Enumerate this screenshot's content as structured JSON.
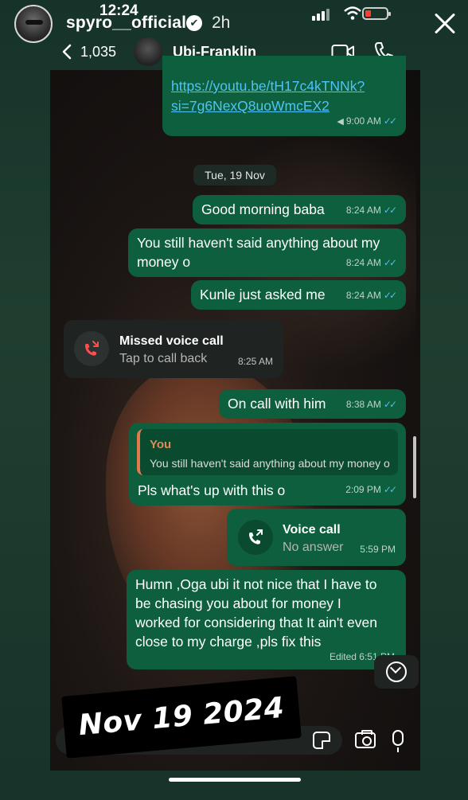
{
  "story": {
    "time": "12:24",
    "username": "spyro__official",
    "verified_mark": "✔",
    "age": "2h",
    "sticker_text": "Nov 19 2024"
  },
  "chat_header": {
    "back_count": "1,035",
    "contact_name": "Ubi-Franklin"
  },
  "messages": {
    "link": {
      "line1": "https://youtu.be/tH17c4kTNNk?",
      "line2": "si=7g6NexQ8uoWmcEX2",
      "time": "9:00 AM",
      "ticks": "✓✓"
    },
    "date_chip": "Tue, 19 Nov",
    "m1": {
      "text": "Good morning baba",
      "time": "8:24 AM",
      "ticks": "✓✓"
    },
    "m2": {
      "line1": "You still haven't said anything about my",
      "line2": "money o",
      "time": "8:24 AM",
      "ticks": "✓✓"
    },
    "m3": {
      "text": "Kunle just asked me",
      "time": "8:24 AM",
      "ticks": "✓✓"
    },
    "missed_call": {
      "title": "Missed voice call",
      "sub": "Tap to call back",
      "time": "8:25 AM"
    },
    "m4": {
      "text": "On call with him",
      "time": "8:38 AM",
      "ticks": "✓✓"
    },
    "reply": {
      "quote_name": "You",
      "quote_text": "You still haven't said anything about my money o",
      "text": "Pls what's up with this o",
      "time": "2:09 PM",
      "ticks": "✓✓"
    },
    "voice_call": {
      "title": "Voice call",
      "sub": "No answer",
      "time": "5:59 PM"
    },
    "m5": {
      "line1": "Humn ,Oga ubi it not nice that I have to",
      "line2": "be chasing you about for money I",
      "line3": "worked for considering that It ain't even",
      "line4": "close to my charge ,pls fix this",
      "time": "Edited 6:51 PM"
    }
  },
  "colors": {
    "outgoing_bubble": "#0d5f3d",
    "incoming_bubble": "#1f2422",
    "read_ticks": "#53bdeb",
    "missed_call": "#ff4d4d"
  },
  "icons": [
    "close-icon",
    "verified-icon",
    "back-chevron-icon",
    "video-call-icon",
    "phone-icon",
    "missed-call-icon",
    "outgoing-call-icon",
    "scroll-down-icon",
    "sticker-icon",
    "camera-icon",
    "mic-icon"
  ]
}
